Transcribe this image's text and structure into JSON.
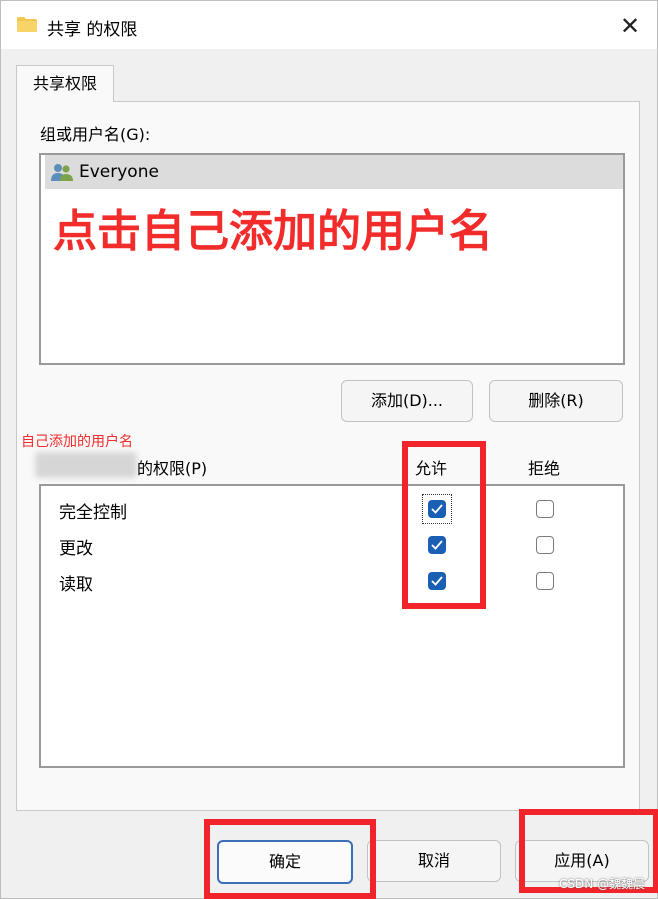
{
  "window": {
    "title": "共享 的权限",
    "close_glyph": "✕"
  },
  "tab": {
    "label": "共享权限"
  },
  "users": {
    "label": "组或用户名(G):",
    "items": [
      {
        "name": "Everyone",
        "icon": "users-icon",
        "selected": true
      }
    ]
  },
  "annotations": {
    "main": "点击自己添加的用户名",
    "small": "自己添加的用户名",
    "color": "#f22b2b"
  },
  "user_buttons": {
    "add": "添加(D)...",
    "remove": "删除(R)"
  },
  "permissions": {
    "label_suffix": "的权限(P)",
    "allow_header": "允许",
    "deny_header": "拒绝",
    "rows": [
      {
        "name": "完全控制",
        "allow": true,
        "deny": false
      },
      {
        "name": "更改",
        "allow": true,
        "deny": false
      },
      {
        "name": "读取",
        "allow": true,
        "deny": false
      }
    ]
  },
  "footer": {
    "ok": "确定",
    "cancel": "取消",
    "apply": "应用(A)"
  },
  "watermark": "CSDN @魏魏晨",
  "colors": {
    "accent": "#1a5fb4",
    "highlight_red": "#f2242b"
  }
}
